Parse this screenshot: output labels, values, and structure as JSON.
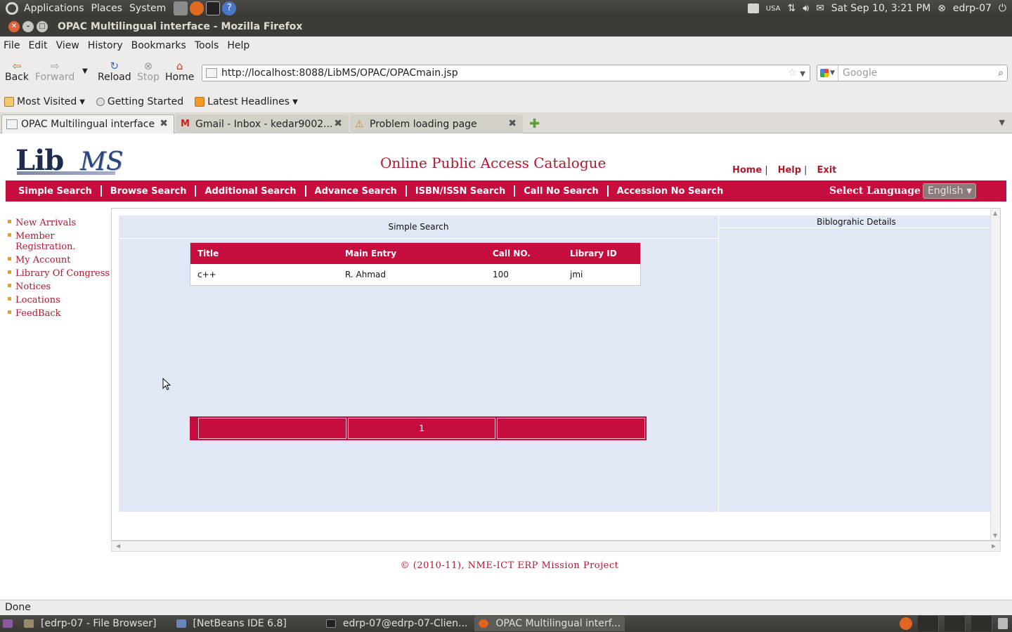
{
  "system_panel": {
    "menus": [
      "Applications",
      "Places",
      "System"
    ],
    "keyboard": "USA",
    "datetime": "Sat Sep 10,  3:21 PM",
    "user": "edrp-07"
  },
  "window": {
    "title": "OPAC Multilingual interface - Mozilla Firefox"
  },
  "menubar": [
    "File",
    "Edit",
    "View",
    "History",
    "Bookmarks",
    "Tools",
    "Help"
  ],
  "navbar": {
    "back": "Back",
    "forward": "Forward",
    "reload": "Reload",
    "stop": "Stop",
    "home": "Home",
    "url": "http://localhost:8088/LibMS/OPAC/OPACmain.jsp",
    "search_placeholder": "Google"
  },
  "bookmarks": [
    "Most Visited",
    "Getting Started",
    "Latest Headlines"
  ],
  "tabs": [
    {
      "label": "OPAC Multilingual interface"
    },
    {
      "label": "Gmail - Inbox - kedar9002..."
    },
    {
      "label": "Problem loading page"
    }
  ],
  "page": {
    "logo_lib": "Lib",
    "logo_ms": "MS",
    "site_title": "Online Public Access Catalogue",
    "top_links": [
      "Home",
      "Help",
      "Exit"
    ],
    "nav_items": [
      "Simple Search",
      "Browse Search",
      "Additional Search",
      "Advance Search",
      "ISBN/ISSN Search",
      "Call No Search",
      "Accession No Search"
    ],
    "language_label": "Select Language",
    "language_value": "English",
    "sidebar": [
      "New Arrivals",
      "Member Registration.",
      "My Account",
      "Library Of Congress",
      "Notices",
      "Locations",
      "FeedBack"
    ],
    "left_panel_title": "Simple Search",
    "right_panel_title": "Biblograhic Details",
    "results": {
      "columns": [
        "Title",
        "Main Entry",
        "Call NO.",
        "Library ID"
      ],
      "rows": [
        [
          "c++",
          "R. Ahmad",
          "100",
          "jmi"
        ]
      ]
    },
    "pager": [
      "",
      "1",
      ""
    ],
    "footer": "© (2010-11), NME-ICT ERP Mission Project"
  },
  "status": "Done",
  "taskbar": [
    "[edrp-07 - File Browser]",
    "[NetBeans IDE 6.8]",
    "edrp-07@edrp-07-Clien...",
    "OPAC Multilingual interf..."
  ],
  "colors": {
    "accent_red": "#c50d3e",
    "panel_blue": "#e1e7f4",
    "link_red": "#b0182f"
  }
}
